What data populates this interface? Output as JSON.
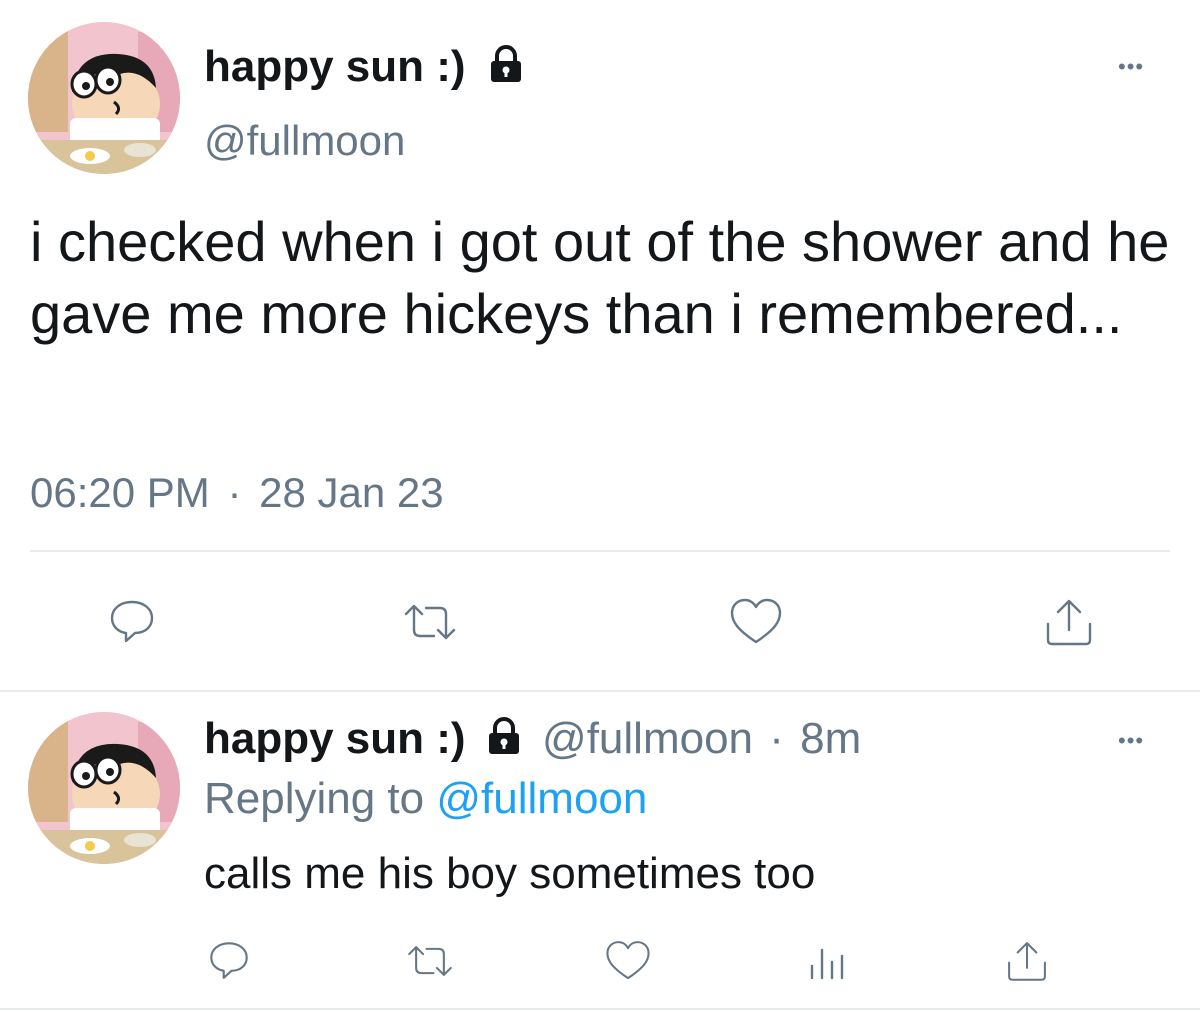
{
  "main_tweet": {
    "display_name": "happy sun :)",
    "handle": "@fullmoon",
    "text": "i checked when i got out of the shower and he gave me more hickeys than i remembered...",
    "time": "06:20 PM",
    "separator": "·",
    "date": "28 Jan 23",
    "more_label": "•••",
    "actions": [
      "reply-icon",
      "retweet-icon",
      "like-icon",
      "share-icon"
    ]
  },
  "reply_tweet": {
    "display_name": "happy sun :)",
    "handle": "@fullmoon",
    "separator": "·",
    "age": "8m",
    "replying_prefix": "Replying to",
    "replying_handle": "@fullmoon",
    "text": "calls me his boy sometimes too",
    "more_label": "•••",
    "actions": [
      "reply-icon",
      "retweet-icon",
      "like-icon",
      "analytics-icon",
      "share-icon"
    ]
  },
  "colors": {
    "text": "#14171a",
    "secondary": "#657786",
    "link": "#1da1f2",
    "divider": "#e6ecf0",
    "avatar_bg": "#f3c6cf"
  }
}
